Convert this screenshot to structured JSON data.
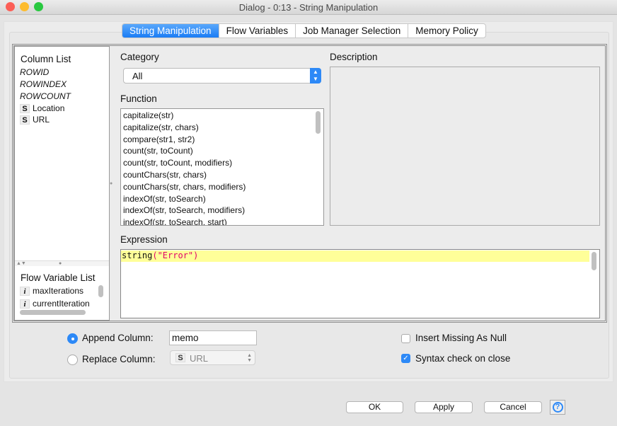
{
  "window": {
    "title": "Dialog - 0:13 - String Manipulation"
  },
  "tabs": [
    "String Manipulation",
    "Flow Variables",
    "Job Manager Selection",
    "Memory Policy"
  ],
  "column_list": {
    "title": "Column List",
    "special": [
      "ROWID",
      "ROWINDEX",
      "ROWCOUNT"
    ],
    "columns": [
      {
        "type": "S",
        "name": "Location"
      },
      {
        "type": "S",
        "name": "URL"
      }
    ]
  },
  "flow_variable_list": {
    "title": "Flow Variable List",
    "items": [
      {
        "type": "i",
        "name": "maxIterations"
      },
      {
        "type": "i",
        "name": "currentIteration"
      }
    ]
  },
  "category": {
    "label": "Category",
    "value": "All"
  },
  "function": {
    "label": "Function",
    "items": [
      "capitalize(str)",
      "capitalize(str, chars)",
      "compare(str1, str2)",
      "count(str, toCount)",
      "count(str, toCount, modifiers)",
      "countChars(str, chars)",
      "countChars(str, chars, modifiers)",
      "indexOf(str, toSearch)",
      "indexOf(str, toSearch, modifiers)",
      "indexOf(str, toSearch, start)"
    ]
  },
  "description": {
    "label": "Description"
  },
  "expression": {
    "label": "Expression",
    "func": "string",
    "args": "(\"Error\")"
  },
  "output": {
    "append_label": "Append Column:",
    "append_value": "memo",
    "replace_label": "Replace Column:",
    "replace_type": "S",
    "replace_value": "URL",
    "mode": "append"
  },
  "options": {
    "insert_missing_label": "Insert Missing As Null",
    "insert_missing": false,
    "syntax_check_label": "Syntax check on close",
    "syntax_check": true
  },
  "buttons": {
    "ok": "OK",
    "apply": "Apply",
    "cancel": "Cancel",
    "help": "?"
  },
  "colors": {
    "accent": "#2d89f7",
    "expression_highlight": "#ffff99",
    "string_literal": "#e0006a"
  }
}
